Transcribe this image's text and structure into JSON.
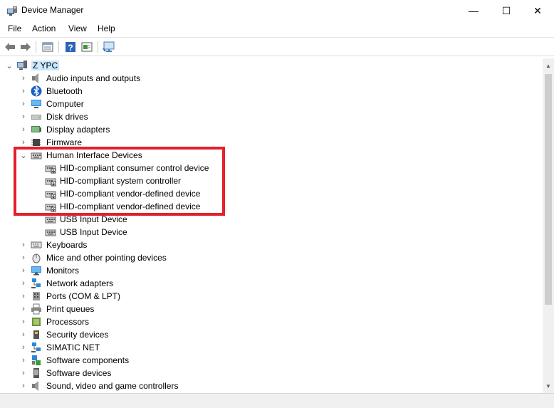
{
  "window": {
    "title": "Device Manager",
    "minimize_glyph": "—",
    "maximize_glyph": "☐",
    "close_glyph": "✕"
  },
  "menu": [
    "File",
    "Action",
    "View",
    "Help"
  ],
  "toolbar": {
    "buttons": [
      "back-arrow-icon",
      "forward-arrow-icon",
      "properties-icon",
      "help-icon",
      "update-driver-icon",
      "monitor-scan-icon"
    ]
  },
  "tree": {
    "root": "Z YPC",
    "categories": [
      {
        "label": "Audio inputs and outputs",
        "icon": "speaker-icon"
      },
      {
        "label": "Bluetooth",
        "icon": "bluetooth-icon"
      },
      {
        "label": "Computer",
        "icon": "computer-icon"
      },
      {
        "label": "Disk drives",
        "icon": "disk-drive-icon"
      },
      {
        "label": "Display adapters",
        "icon": "display-adapter-icon"
      },
      {
        "label": "Firmware",
        "icon": "firmware-icon"
      },
      {
        "label": "Human Interface Devices",
        "icon": "hid-icon",
        "expanded": true,
        "children": [
          "HID-compliant consumer control device",
          "HID-compliant system controller",
          "HID-compliant vendor-defined device",
          "HID-compliant vendor-defined device",
          "USB Input Device",
          "USB Input Device"
        ]
      },
      {
        "label": "Keyboards",
        "icon": "keyboard-icon"
      },
      {
        "label": "Mice and other pointing devices",
        "icon": "mouse-icon"
      },
      {
        "label": "Monitors",
        "icon": "monitor-icon"
      },
      {
        "label": "Network adapters",
        "icon": "network-adapter-icon"
      },
      {
        "label": "Ports (COM & LPT)",
        "icon": "port-icon"
      },
      {
        "label": "Print queues",
        "icon": "printer-icon"
      },
      {
        "label": "Processors",
        "icon": "processor-icon"
      },
      {
        "label": "Security devices",
        "icon": "security-device-icon"
      },
      {
        "label": "SIMATIC NET",
        "icon": "network-adapter-icon"
      },
      {
        "label": "Software components",
        "icon": "software-component-icon"
      },
      {
        "label": "Software devices",
        "icon": "software-device-icon"
      },
      {
        "label": "Sound, video and game controllers",
        "icon": "speaker-icon"
      }
    ]
  },
  "highlight_color": "#e3202b",
  "selection_color": "#cce8ff"
}
